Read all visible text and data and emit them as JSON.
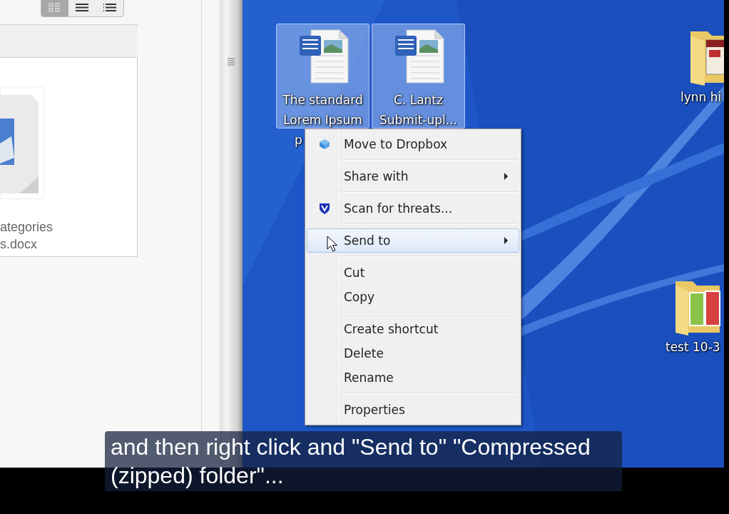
{
  "file_view": {
    "view_buttons": [
      {
        "kind": "grid",
        "selected": true
      },
      {
        "kind": "list",
        "selected": false
      },
      {
        "kind": "details",
        "selected": false
      }
    ],
    "files": [
      {
        "name_lines": [
          "ategories",
          "s.docx"
        ]
      }
    ]
  },
  "desktop": {
    "icons": [
      {
        "kind": "document",
        "label_lines": [
          "The standard",
          "Lorem Ipsum",
          "p"
        ],
        "selected": true
      },
      {
        "kind": "document",
        "label_lines": [
          "C. Lantz",
          "Submit-upl..."
        ],
        "selected": true
      },
      {
        "kind": "folder-web",
        "label_lines": [
          "lynn hi"
        ],
        "selected": false
      },
      {
        "kind": "folder-film",
        "label_lines": [
          "test 10-3"
        ],
        "selected": false
      }
    ]
  },
  "context_menu": {
    "items": [
      {
        "kind": "item",
        "label": "Move to Dropbox",
        "submenu": false,
        "selected": false
      },
      {
        "kind": "separator"
      },
      {
        "kind": "item",
        "label": "Share with",
        "submenu": true,
        "selected": false
      },
      {
        "kind": "separator"
      },
      {
        "kind": "item",
        "label": "Scan for threats...",
        "submenu": false,
        "selected": false
      },
      {
        "kind": "separator"
      },
      {
        "kind": "item",
        "label": "Send to",
        "submenu": true,
        "selected": true
      },
      {
        "kind": "separator"
      },
      {
        "kind": "item",
        "label": "Cut",
        "submenu": false,
        "selected": false
      },
      {
        "kind": "item",
        "label": "Copy",
        "submenu": false,
        "selected": false
      },
      {
        "kind": "separator"
      },
      {
        "kind": "item",
        "label": "Create shortcut",
        "submenu": false,
        "selected": false
      },
      {
        "kind": "item",
        "label": "Delete",
        "submenu": false,
        "selected": false
      },
      {
        "kind": "item",
        "label": "Rename",
        "submenu": false,
        "selected": false
      },
      {
        "kind": "separator"
      },
      {
        "kind": "item",
        "label": "Properties",
        "submenu": false,
        "selected": false
      }
    ]
  },
  "caption": "and then right click and \"Send to\" \"Compressed (zipped) folder\"..."
}
